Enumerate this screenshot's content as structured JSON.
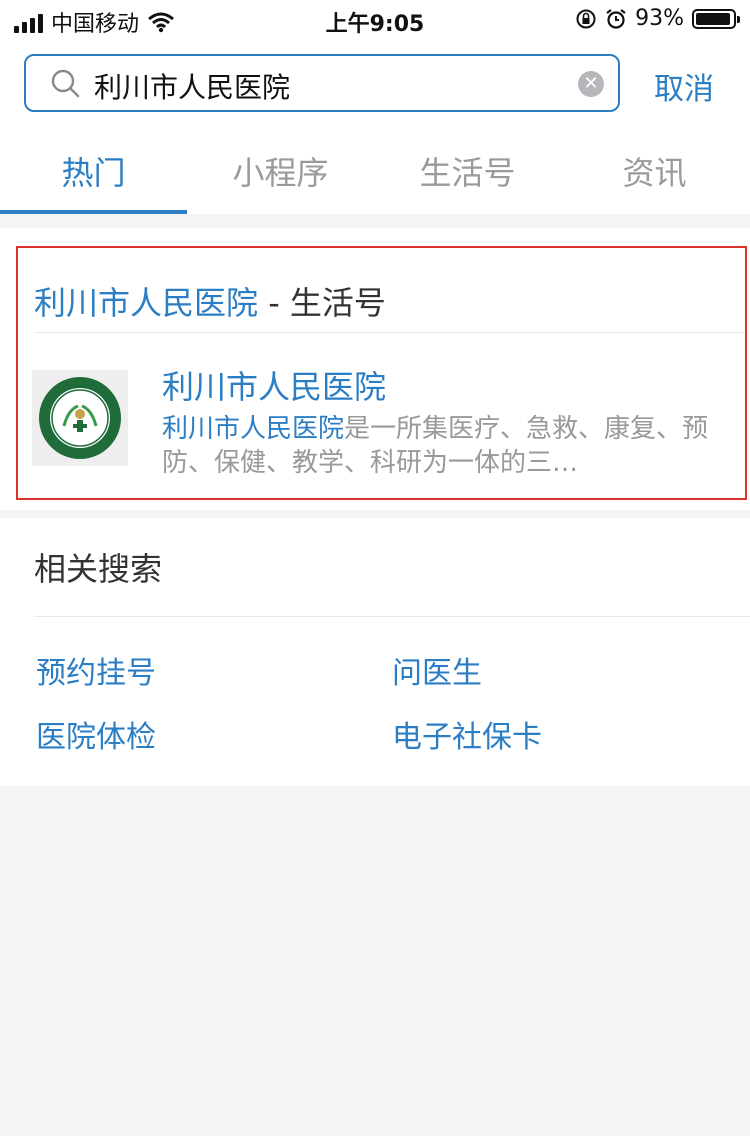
{
  "status_bar": {
    "carrier": "中国移动",
    "time": "上午9:05",
    "battery": "93%"
  },
  "search": {
    "query": "利川市人民医院",
    "cancel_label": "取消"
  },
  "tabs": [
    {
      "label": "热门"
    },
    {
      "label": "小程序"
    },
    {
      "label": "生活号"
    },
    {
      "label": "资讯"
    }
  ],
  "result": {
    "header_highlight": "利川市人民医院",
    "header_suffix": " - 生活号",
    "title": "利川市人民医院",
    "desc_highlight": "利川市人民医院",
    "desc_rest": "是一所集医疗、急救、康复、预防、保健、教学、科研为一体的三…"
  },
  "related": {
    "title": "相关搜索",
    "links": [
      "预约挂号",
      "问医生",
      "医院体检",
      "电子社保卡"
    ]
  },
  "colors": {
    "accent": "#2b7ec4",
    "highlight_border": "#d9352b",
    "page_bg": "#f4f4f7"
  }
}
